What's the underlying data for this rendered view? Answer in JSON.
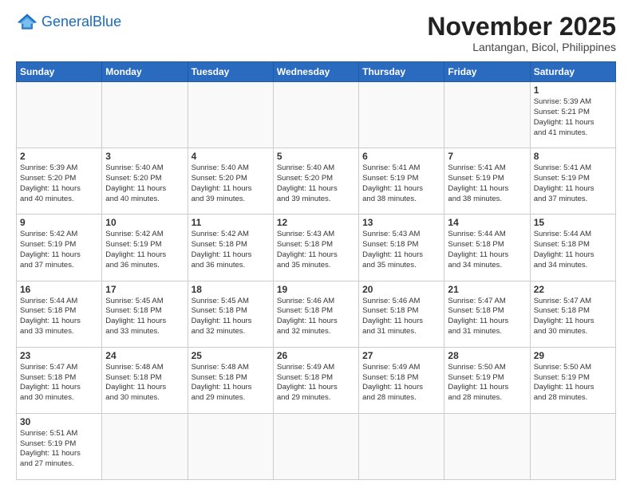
{
  "header": {
    "logo_general": "General",
    "logo_blue": "Blue",
    "title": "November 2025",
    "subtitle": "Lantangan, Bicol, Philippines"
  },
  "calendar": {
    "days_of_week": [
      "Sunday",
      "Monday",
      "Tuesday",
      "Wednesday",
      "Thursday",
      "Friday",
      "Saturday"
    ],
    "weeks": [
      [
        {
          "day": null,
          "content": ""
        },
        {
          "day": null,
          "content": ""
        },
        {
          "day": null,
          "content": ""
        },
        {
          "day": null,
          "content": ""
        },
        {
          "day": null,
          "content": ""
        },
        {
          "day": null,
          "content": ""
        },
        {
          "day": "1",
          "content": "Sunrise: 5:39 AM\nSunset: 5:21 PM\nDaylight: 11 hours\nand 41 minutes."
        }
      ],
      [
        {
          "day": "2",
          "content": "Sunrise: 5:39 AM\nSunset: 5:20 PM\nDaylight: 11 hours\nand 40 minutes."
        },
        {
          "day": "3",
          "content": "Sunrise: 5:40 AM\nSunset: 5:20 PM\nDaylight: 11 hours\nand 40 minutes."
        },
        {
          "day": "4",
          "content": "Sunrise: 5:40 AM\nSunset: 5:20 PM\nDaylight: 11 hours\nand 39 minutes."
        },
        {
          "day": "5",
          "content": "Sunrise: 5:40 AM\nSunset: 5:20 PM\nDaylight: 11 hours\nand 39 minutes."
        },
        {
          "day": "6",
          "content": "Sunrise: 5:41 AM\nSunset: 5:19 PM\nDaylight: 11 hours\nand 38 minutes."
        },
        {
          "day": "7",
          "content": "Sunrise: 5:41 AM\nSunset: 5:19 PM\nDaylight: 11 hours\nand 38 minutes."
        },
        {
          "day": "8",
          "content": "Sunrise: 5:41 AM\nSunset: 5:19 PM\nDaylight: 11 hours\nand 37 minutes."
        }
      ],
      [
        {
          "day": "9",
          "content": "Sunrise: 5:42 AM\nSunset: 5:19 PM\nDaylight: 11 hours\nand 37 minutes."
        },
        {
          "day": "10",
          "content": "Sunrise: 5:42 AM\nSunset: 5:19 PM\nDaylight: 11 hours\nand 36 minutes."
        },
        {
          "day": "11",
          "content": "Sunrise: 5:42 AM\nSunset: 5:18 PM\nDaylight: 11 hours\nand 36 minutes."
        },
        {
          "day": "12",
          "content": "Sunrise: 5:43 AM\nSunset: 5:18 PM\nDaylight: 11 hours\nand 35 minutes."
        },
        {
          "day": "13",
          "content": "Sunrise: 5:43 AM\nSunset: 5:18 PM\nDaylight: 11 hours\nand 35 minutes."
        },
        {
          "day": "14",
          "content": "Sunrise: 5:44 AM\nSunset: 5:18 PM\nDaylight: 11 hours\nand 34 minutes."
        },
        {
          "day": "15",
          "content": "Sunrise: 5:44 AM\nSunset: 5:18 PM\nDaylight: 11 hours\nand 34 minutes."
        }
      ],
      [
        {
          "day": "16",
          "content": "Sunrise: 5:44 AM\nSunset: 5:18 PM\nDaylight: 11 hours\nand 33 minutes."
        },
        {
          "day": "17",
          "content": "Sunrise: 5:45 AM\nSunset: 5:18 PM\nDaylight: 11 hours\nand 33 minutes."
        },
        {
          "day": "18",
          "content": "Sunrise: 5:45 AM\nSunset: 5:18 PM\nDaylight: 11 hours\nand 32 minutes."
        },
        {
          "day": "19",
          "content": "Sunrise: 5:46 AM\nSunset: 5:18 PM\nDaylight: 11 hours\nand 32 minutes."
        },
        {
          "day": "20",
          "content": "Sunrise: 5:46 AM\nSunset: 5:18 PM\nDaylight: 11 hours\nand 31 minutes."
        },
        {
          "day": "21",
          "content": "Sunrise: 5:47 AM\nSunset: 5:18 PM\nDaylight: 11 hours\nand 31 minutes."
        },
        {
          "day": "22",
          "content": "Sunrise: 5:47 AM\nSunset: 5:18 PM\nDaylight: 11 hours\nand 30 minutes."
        }
      ],
      [
        {
          "day": "23",
          "content": "Sunrise: 5:47 AM\nSunset: 5:18 PM\nDaylight: 11 hours\nand 30 minutes."
        },
        {
          "day": "24",
          "content": "Sunrise: 5:48 AM\nSunset: 5:18 PM\nDaylight: 11 hours\nand 30 minutes."
        },
        {
          "day": "25",
          "content": "Sunrise: 5:48 AM\nSunset: 5:18 PM\nDaylight: 11 hours\nand 29 minutes."
        },
        {
          "day": "26",
          "content": "Sunrise: 5:49 AM\nSunset: 5:18 PM\nDaylight: 11 hours\nand 29 minutes."
        },
        {
          "day": "27",
          "content": "Sunrise: 5:49 AM\nSunset: 5:18 PM\nDaylight: 11 hours\nand 28 minutes."
        },
        {
          "day": "28",
          "content": "Sunrise: 5:50 AM\nSunset: 5:19 PM\nDaylight: 11 hours\nand 28 minutes."
        },
        {
          "day": "29",
          "content": "Sunrise: 5:50 AM\nSunset: 5:19 PM\nDaylight: 11 hours\nand 28 minutes."
        }
      ],
      [
        {
          "day": "30",
          "content": "Sunrise: 5:51 AM\nSunset: 5:19 PM\nDaylight: 11 hours\nand 27 minutes."
        },
        {
          "day": null,
          "content": ""
        },
        {
          "day": null,
          "content": ""
        },
        {
          "day": null,
          "content": ""
        },
        {
          "day": null,
          "content": ""
        },
        {
          "day": null,
          "content": ""
        },
        {
          "day": null,
          "content": ""
        }
      ]
    ]
  }
}
